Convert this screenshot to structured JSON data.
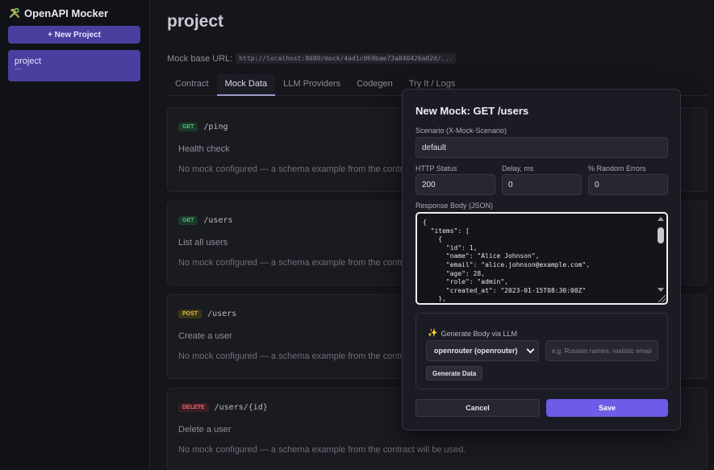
{
  "app": {
    "title": "OpenAPI Mocker",
    "new_project_label": "+ New Project"
  },
  "sidebar": {
    "projects": [
      {
        "name": "project",
        "subtitle": "—"
      }
    ]
  },
  "main": {
    "title": "project",
    "base_url_label": "Mock base URL:",
    "base_url_value": "http://localhost:8080/mock/4ad1c069bae73a840426a02d/...",
    "tabs": [
      {
        "label": "Contract",
        "active": false
      },
      {
        "label": "Mock Data",
        "active": true
      },
      {
        "label": "LLM Providers",
        "active": false
      },
      {
        "label": "Codegen",
        "active": false
      },
      {
        "label": "Try It / Logs",
        "active": false
      }
    ],
    "endpoints": [
      {
        "method": "GET",
        "path": "/ping",
        "summary": "Health check",
        "note": "No mock configured — a schema example from the contract will be used."
      },
      {
        "method": "GET",
        "path": "/users",
        "summary": "List all users",
        "note": "No mock configured — a schema example from the contract will be used."
      },
      {
        "method": "POST",
        "path": "/users",
        "summary": "Create a user",
        "note": "No mock configured — a schema example from the contract will be used."
      },
      {
        "method": "DELETE",
        "path": "/users/{id}",
        "summary": "Delete a user",
        "note": "No mock configured — a schema example from the contract will be used."
      }
    ]
  },
  "modal": {
    "title": "New Mock: GET /users",
    "scenario_label": "Scenario (X-Mock-Scenario)",
    "scenario_value": "default",
    "status_label": "HTTP Status",
    "status_value": "200",
    "delay_label": "Delay, ms",
    "delay_value": "0",
    "random_errors_label": "% Random Errors",
    "random_errors_value": "0",
    "body_label": "Response Body (JSON)",
    "body_value": "{\n  \"items\": [\n    {\n      \"id\": 1,\n      \"name\": \"Alice Johnson\",\n      \"email\": \"alice.johnson@example.com\",\n      \"age\": 28,\n      \"role\": \"admin\",\n      \"created_at\": \"2023-01-15T08:30:00Z\"\n    },\n    {",
    "llm_title": "Generate Body via LLM",
    "llm_provider_selected": "openrouter (openrouter)",
    "llm_hint_placeholder": "e.g. Russian names, realistic emails",
    "generate_label": "Generate Data",
    "cancel_label": "Cancel",
    "save_label": "Save"
  },
  "colors": {
    "accent": "#6c5ce7",
    "sidebar_active": "#4a3f9e",
    "get": "#4fbd7a",
    "post": "#d8b84a",
    "delete": "#e06a73"
  }
}
